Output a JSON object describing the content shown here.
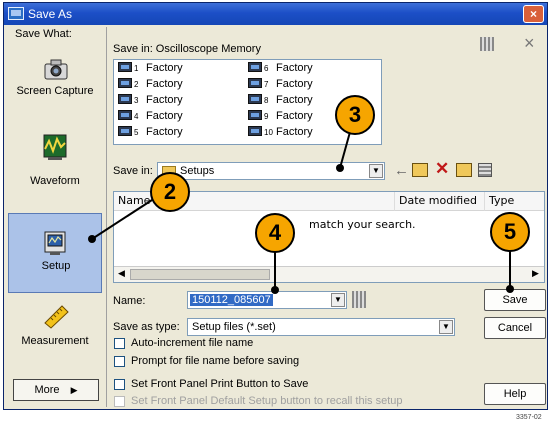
{
  "window": {
    "title": "Save As",
    "close_label": "×"
  },
  "left_pane": {
    "header": "Save What:",
    "items": [
      {
        "label": "Screen Capture"
      },
      {
        "label": "Waveform"
      },
      {
        "label": "Setup",
        "selected": true
      },
      {
        "label": "Measurement"
      }
    ],
    "more_label": "More",
    "more_arrow": "▶"
  },
  "memory": {
    "save_in_label": "Save in: Oscilloscope Memory",
    "slots": [
      {
        "num": "1",
        "label": "Factory"
      },
      {
        "num": "2",
        "label": "Factory"
      },
      {
        "num": "3",
        "label": "Factory"
      },
      {
        "num": "4",
        "label": "Factory"
      },
      {
        "num": "5",
        "label": "Factory"
      },
      {
        "num": "6",
        "label": "Factory"
      },
      {
        "num": "7",
        "label": "Factory"
      },
      {
        "num": "8",
        "label": "Factory"
      },
      {
        "num": "9",
        "label": "Factory"
      },
      {
        "num": "10",
        "label": "Factory"
      }
    ],
    "top_right_close": "×"
  },
  "save_in": {
    "label": "Save in:",
    "value": "Setups"
  },
  "toolbar_icons": [
    "back-arrow-icon",
    "up-folder-icon",
    "delete-icon",
    "new-folder-icon",
    "views-menu-icon"
  ],
  "file_list": {
    "columns": [
      "Name",
      "Date modified",
      "Type"
    ],
    "empty_message": "match your search."
  },
  "form": {
    "name_label": "Name:",
    "name_value": "150112_085607",
    "type_label": "Save as type:",
    "type_value": "Setup files (*.set)",
    "checkboxes": [
      {
        "label": "Auto-increment file name",
        "checked": false,
        "enabled": true
      },
      {
        "label": "Prompt for file name before saving",
        "checked": false,
        "enabled": true
      },
      {
        "label": "Set Front Panel Print Button to Save",
        "checked": false,
        "enabled": true
      },
      {
        "label": "Set Front Panel Default Setup button to recall this setup",
        "checked": false,
        "enabled": false
      }
    ]
  },
  "buttons": {
    "save": "Save",
    "cancel": "Cancel",
    "help": "Help"
  },
  "callouts": [
    "2",
    "3",
    "4",
    "5"
  ],
  "figure_id": "3357-02",
  "colors": {
    "title_bar": "#1c4fc7",
    "callout_fill": "#f6a500",
    "selected_item": "#abc2e8",
    "close_button": "#d9603a"
  }
}
